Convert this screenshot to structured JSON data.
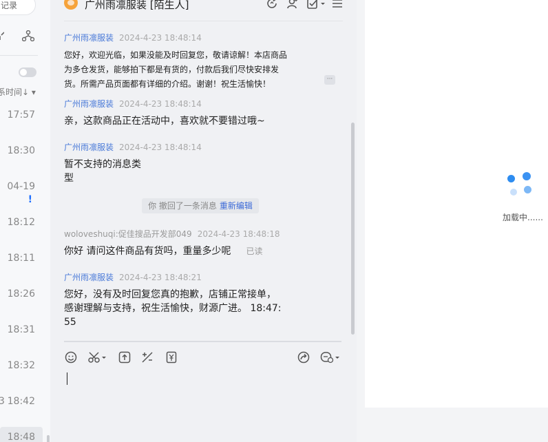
{
  "left_panel": {
    "search_partial": "记录",
    "sort_label": "系时间↓ ▾",
    "conversations": [
      {
        "time": "17:57"
      },
      {
        "time": "18:30"
      },
      {
        "time": "04-19",
        "alert": "!"
      },
      {
        "time": "18:12"
      },
      {
        "time": "18:11"
      },
      {
        "time": "18:26"
      },
      {
        "time": "18:31"
      },
      {
        "time": "18:32"
      },
      {
        "time": "18:42",
        "partial_char": "3"
      },
      {
        "time": "18:48"
      }
    ]
  },
  "chat": {
    "header": {
      "title": "广州雨凛服装 [陌生人]"
    },
    "messages": [
      {
        "sender": "广州雨凛服装",
        "time": "2024-4-23 18:48:14",
        "lines": [
          "您好，欢迎光临，如果没能及时回复您，敬请谅解！本店商品",
          "为多仓发货，能够拍下都是有货的，付款后我们尽快安排发",
          "货。所需产品页面都有详细的介绍。谢谢！祝生活愉快！"
        ]
      },
      {
        "sender": "广州雨凛服装",
        "time": "2024-4-23 18:48:14",
        "lines": [
          "亲，这款商品正在活动中，喜欢就不要错过哦~"
        ]
      },
      {
        "sender": "广州雨凛服装",
        "time": "2024-4-23 18:48:14",
        "lines": [
          "暂不支持的消息类",
          "型"
        ]
      },
      {
        "sender": "woloveshuqi:促佳搜品开发部049",
        "time": "2024-4-23 18:48:18",
        "lines": [
          "你好 请问这件商品有货吗，重量多少呢"
        ],
        "read_status": "已读"
      },
      {
        "sender": "广州雨凛服装",
        "time": "2024-4-23 18:48:21",
        "lines": [
          "您好，没有及时回复您真的抱歉，店铺正常接单，",
          "感谢理解与支持，祝生活愉快，财源广进。 18:47:",
          "55"
        ]
      }
    ],
    "recall_notice": "你 撤回了一条消息",
    "recall_action": "重新编辑",
    "more_chip": "···"
  },
  "right_panel": {
    "loading_text": "加载中......"
  },
  "colors": {
    "accent": "#1e6fff",
    "shop_sender": "#4a7ad8",
    "spinner_primary": "#2d8cf0",
    "spinner_light": "#c9e0fb"
  }
}
